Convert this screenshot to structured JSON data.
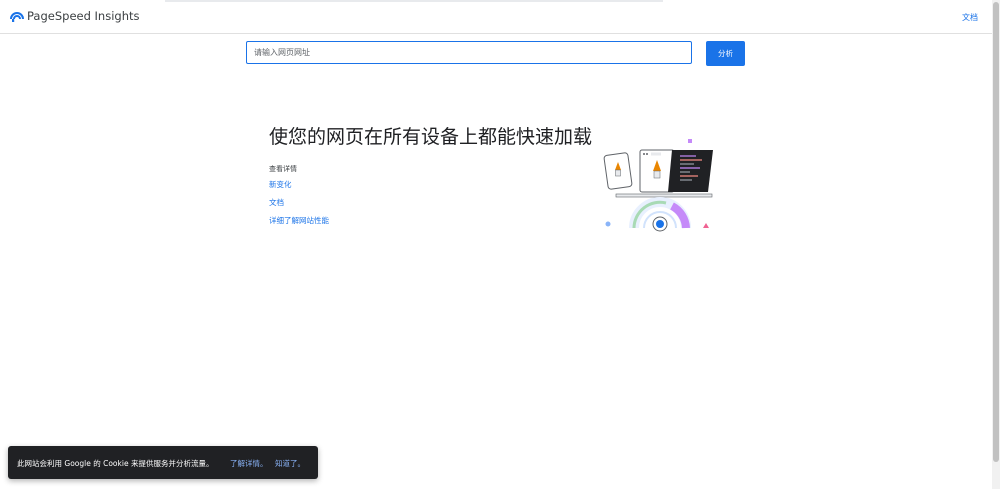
{
  "header": {
    "app_title": "PageSpeed Insights",
    "docs_label": "文档",
    "logo_icon": "pagespeed-logo-icon"
  },
  "search": {
    "placeholder": "请输入网页网址",
    "value": "",
    "analyze_label": "分析"
  },
  "hero": {
    "title": "使您的网页在所有设备上都能快速加载",
    "details_heading": "查看详情",
    "links": [
      "新变化",
      "文档",
      "详细了解网站性能"
    ],
    "illustration_icon": "speed-devices-illustration"
  },
  "cookie_banner": {
    "text": "此网站会利用 Google 的 Cookie 来提供服务并分析流量。",
    "learn_more_label": "了解详情。",
    "ok_label": "知道了。"
  },
  "colors": {
    "accent": "#1a73e8",
    "cookie_bg": "#202124",
    "cookie_link": "#8ab4f8"
  }
}
